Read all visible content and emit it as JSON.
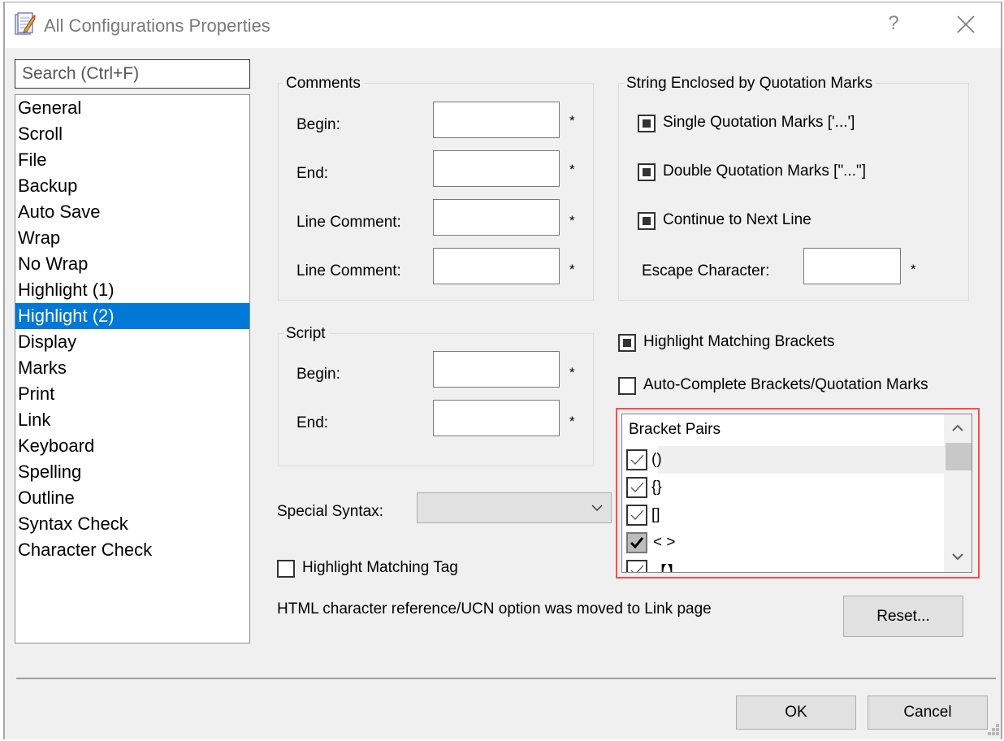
{
  "window": {
    "title": "All Configurations Properties",
    "help_label": "?",
    "icon": "notepad-pencil-icon"
  },
  "sidebar": {
    "search_placeholder": "Search (Ctrl+F)",
    "items": [
      {
        "label": "General"
      },
      {
        "label": "Scroll"
      },
      {
        "label": "File"
      },
      {
        "label": "Backup"
      },
      {
        "label": "Auto Save"
      },
      {
        "label": "Wrap"
      },
      {
        "label": "No Wrap"
      },
      {
        "label": "Highlight (1)"
      },
      {
        "label": "Highlight (2)",
        "selected": true
      },
      {
        "label": "Display"
      },
      {
        "label": "Marks"
      },
      {
        "label": "Print"
      },
      {
        "label": "Link"
      },
      {
        "label": "Keyboard"
      },
      {
        "label": "Spelling"
      },
      {
        "label": "Outline"
      },
      {
        "label": "Syntax Check"
      },
      {
        "label": "Character Check"
      }
    ]
  },
  "comments": {
    "title": "Comments",
    "fields": [
      {
        "label": "Begin:",
        "value": "",
        "marker": "*"
      },
      {
        "label": "End:",
        "value": "",
        "marker": "*"
      },
      {
        "label": "Line Comment:",
        "value": "",
        "marker": "*"
      },
      {
        "label": "Line Comment:",
        "value": "",
        "marker": "*"
      }
    ]
  },
  "script": {
    "title": "Script",
    "fields": [
      {
        "label": "Begin:",
        "value": "",
        "marker": "*"
      },
      {
        "label": "End:",
        "value": "",
        "marker": "*"
      }
    ]
  },
  "strings": {
    "title": "String Enclosed by Quotation Marks",
    "options": [
      {
        "label": "Single Quotation Marks ['...']",
        "checked": "indeterminate"
      },
      {
        "label": "Double Quotation Marks [\"...\"]",
        "checked": "indeterminate"
      },
      {
        "label": "Continue to Next Line",
        "checked": "indeterminate"
      }
    ],
    "escape_label": "Escape Character:",
    "escape_value": "",
    "escape_marker": "*"
  },
  "highlight_matching_brackets": {
    "label": "Highlight Matching Brackets",
    "checked": "indeterminate"
  },
  "auto_complete": {
    "label": "Auto-Complete Brackets/Quotation Marks",
    "checked": false
  },
  "bracket_pairs": {
    "header": "Bracket Pairs",
    "items": [
      {
        "label": "()",
        "checked": true
      },
      {
        "label": "{}",
        "checked": true
      },
      {
        "label": "[]",
        "checked": true
      },
      {
        "label": "< >",
        "checked": "indeterminate"
      },
      {
        "label": "【】",
        "checked": true
      }
    ]
  },
  "special_syntax": {
    "label": "Special Syntax:",
    "value": ""
  },
  "highlight_matching_tag": {
    "label": "Highlight Matching Tag",
    "checked": false
  },
  "info_text": "HTML character reference/UCN option was moved to Link page",
  "buttons": {
    "reset": "Reset...",
    "ok": "OK",
    "cancel": "Cancel"
  },
  "colors": {
    "selection": "#0078d7",
    "highlight_frame": "#f05050"
  }
}
